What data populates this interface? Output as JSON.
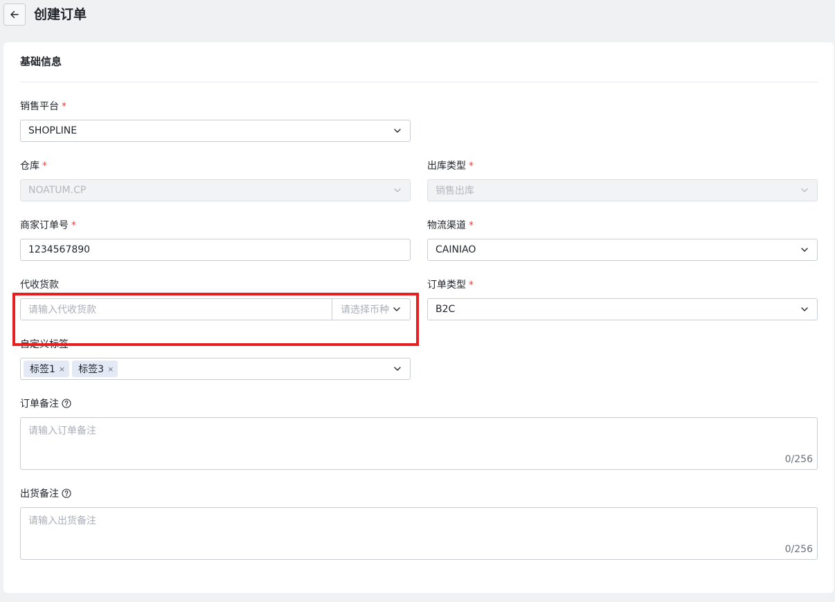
{
  "header": {
    "back_icon": "arrow-left-icon",
    "title": "创建订单"
  },
  "section": {
    "title": "基础信息"
  },
  "fields": {
    "sales_platform": {
      "label": "销售平台",
      "required": "*",
      "value": "SHOPLINE"
    },
    "warehouse": {
      "label": "仓库",
      "required": "*",
      "value": "NOATUM.CP"
    },
    "outbound_type": {
      "label": "出库类型",
      "required": "*",
      "value": "销售出库"
    },
    "merchant_order_no": {
      "label": "商家订单号",
      "required": "*",
      "value": "1234567890"
    },
    "logistics_channel": {
      "label": "物流渠道",
      "required": "*",
      "value": "CAINIAO"
    },
    "cod": {
      "label": "代收货款",
      "amount_placeholder": "请输入代收货款",
      "currency_placeholder": "请选择币种"
    },
    "order_type": {
      "label": "订单类型",
      "required": "*",
      "value": "B2C"
    },
    "custom_tags": {
      "label": "自定义标签",
      "tags": [
        "标签1",
        "标签3"
      ],
      "close_glyph": "×"
    },
    "order_remark": {
      "label": "订单备注",
      "placeholder": "请输入订单备注",
      "counter": "0/256"
    },
    "shipping_remark": {
      "label": "出货备注",
      "placeholder": "请输入出货备注",
      "counter": "0/256"
    }
  },
  "colors": {
    "required": "#f53f3f",
    "highlight": "#e62020",
    "tag_bg": "#e3eaf6"
  }
}
